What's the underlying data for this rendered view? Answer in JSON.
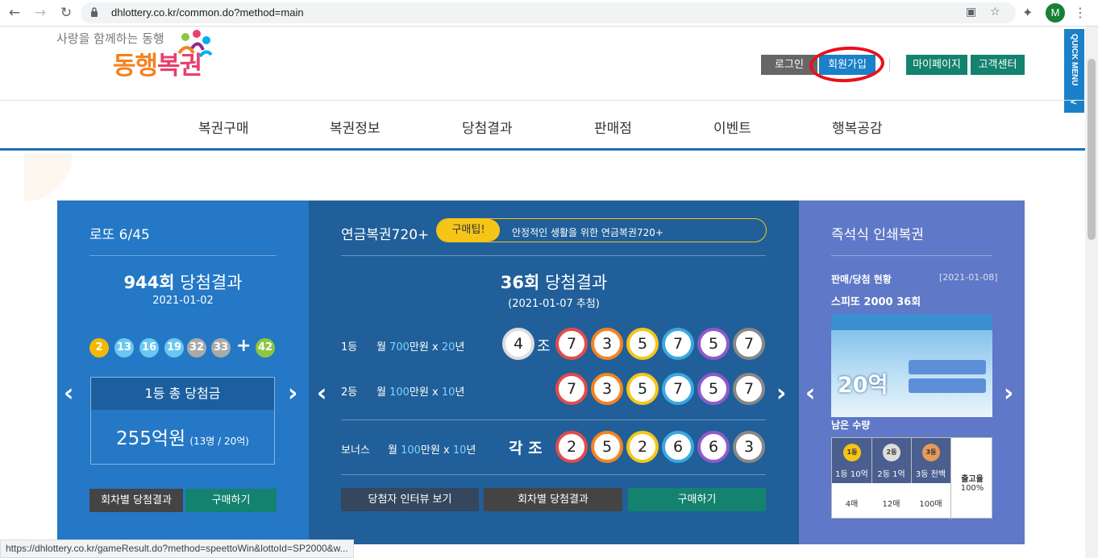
{
  "browser": {
    "url": "dhlottery.co.kr/common.do?method=main",
    "profile_initial": "M",
    "status_url": "https://dhlottery.co.kr/gameResult.do?method=speettoWin&lottoId=SP2000&w..."
  },
  "header": {
    "slogan": "사랑을 함께하는 동행",
    "logo_a": "동행",
    "logo_b": "복권",
    "login": "로그인",
    "join": "회원가입",
    "mypage": "마이페이지",
    "support": "고객센터",
    "quick_menu": "QUICK MENU",
    "quick_arrow": "<"
  },
  "nav": [
    "복권구매",
    "복권정보",
    "당첨결과",
    "판매점",
    "이벤트",
    "행복공감"
  ],
  "lotto": {
    "title": "로또 6/45",
    "round": "944회",
    "round_suffix": " 당첨결과",
    "date": "2021-01-02",
    "numbers": [
      "2",
      "13",
      "16",
      "19",
      "32",
      "33"
    ],
    "plus": "+",
    "bonus": "42",
    "prize_label": "1등 총 당첨금",
    "prize_amount": "255억원",
    "prize_detail": "(13명 / 20억)",
    "btn_results": "회차별 당첨결과",
    "btn_buy": "구매하기"
  },
  "pension": {
    "title": "연금복권720+",
    "tip_badge": "구매팁!",
    "tip_text": "안정적인 생활을 위한 연금복권720+",
    "round": "36회",
    "round_suffix": " 당첨결과",
    "date": "(2021-01-07 추첨)",
    "first_rank": "1등",
    "first_desc_a": "월 ",
    "first_amount": "700",
    "first_desc_b": "만원 x ",
    "first_years": "20",
    "first_desc_c": "년",
    "group": "4",
    "group_suffix": "조",
    "first_numbers": [
      "7",
      "3",
      "5",
      "7",
      "5",
      "7"
    ],
    "second_rank": "2등",
    "second_desc_a": "월 ",
    "second_amount": "100",
    "second_desc_b": "만원 x ",
    "second_years": "10",
    "second_desc_c": "년",
    "second_numbers": [
      "7",
      "3",
      "5",
      "7",
      "5",
      "7"
    ],
    "bonus_rank": "보너스",
    "bonus_desc_a": "월 ",
    "bonus_amount": "100",
    "bonus_desc_b": "만원 x ",
    "bonus_years": "10",
    "bonus_desc_c": "년",
    "bonus_group": "각 조",
    "bonus_numbers": [
      "2",
      "5",
      "2",
      "6",
      "6",
      "3"
    ],
    "btn_interview": "당첨자 인터뷰 보기",
    "btn_results": "회차별 당첨결과",
    "btn_buy": "구매하기"
  },
  "instant": {
    "title": "즉석식 인쇄복권",
    "status_label": "판매/당첨 현황",
    "status_date": "[2021-01-08]",
    "game": "스피또 2000 36회",
    "ticket_amount": "20억",
    "remaining_label": "남은 수량",
    "prizes": [
      {
        "icon": "1등",
        "label": "1등 10억",
        "remain": "4매"
      },
      {
        "icon": "2등",
        "label": "2등 1억",
        "remain": "12매"
      },
      {
        "icon": "3등",
        "label": "3등 천백",
        "remain": "100매"
      }
    ],
    "ship_label": "출고율",
    "ship_rate": "100%"
  },
  "colors": {
    "lotto_panel": "#2478c5",
    "pension_panel": "#205f99",
    "instant_panel": "#5f78c7",
    "accent_teal": "#13826e",
    "join_button": "#1a80c8"
  }
}
